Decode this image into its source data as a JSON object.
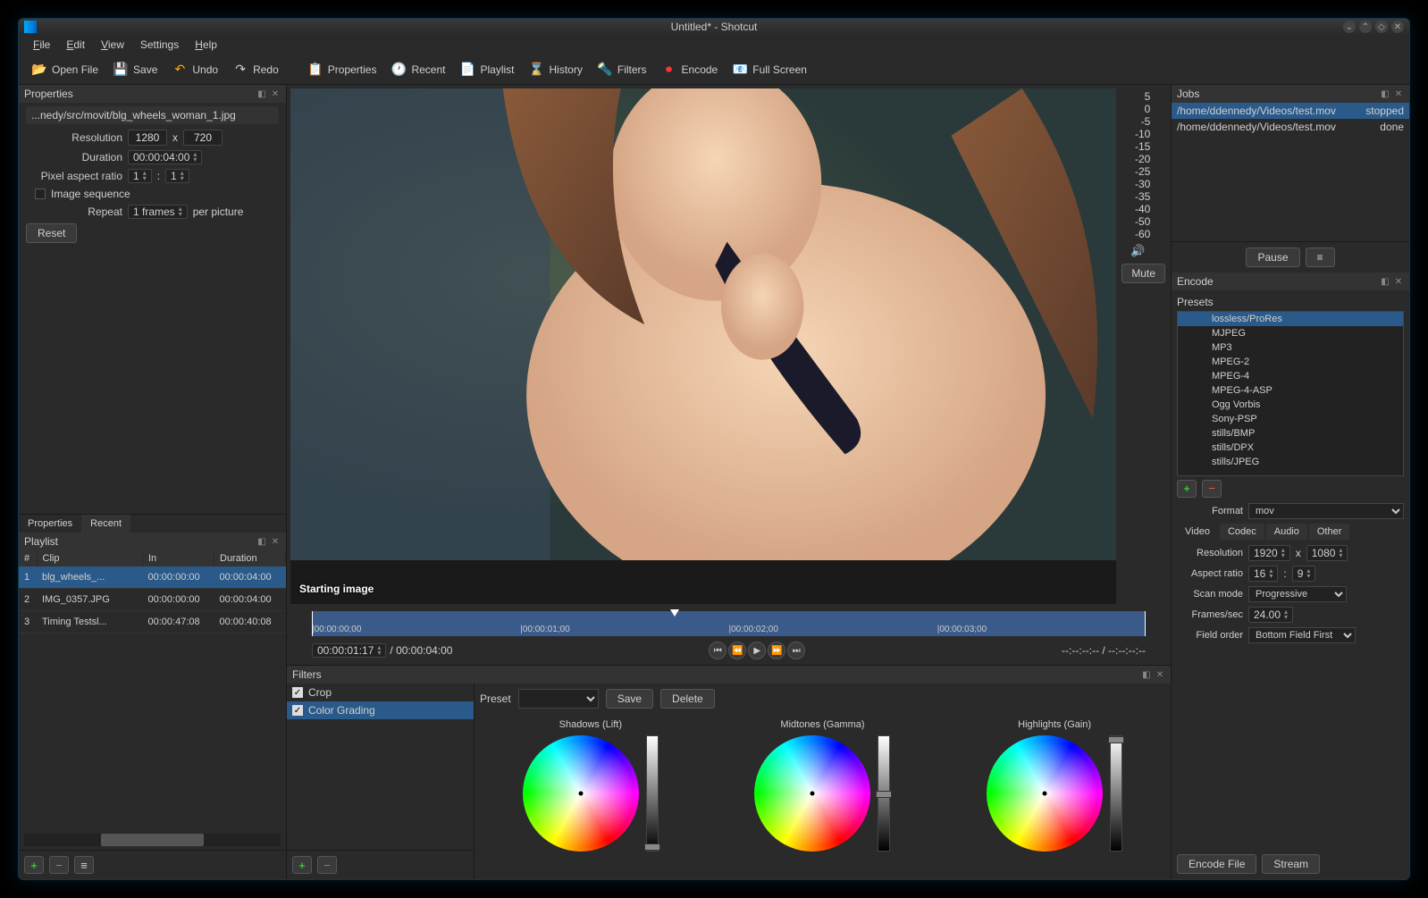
{
  "window": {
    "title": "Untitled* - Shotcut"
  },
  "menu": {
    "file": "File",
    "edit": "Edit",
    "view": "View",
    "settings": "Settings",
    "help": "Help"
  },
  "toolbar": {
    "open": "Open File",
    "save": "Save",
    "undo": "Undo",
    "redo": "Redo",
    "properties": "Properties",
    "recent": "Recent",
    "playlist": "Playlist",
    "history": "History",
    "filters": "Filters",
    "encode": "Encode",
    "fullscreen": "Full Screen"
  },
  "properties": {
    "title": "Properties",
    "filename": "...nedy/src/movit/blg_wheels_woman_1.jpg",
    "resolution_label": "Resolution",
    "res_w": "1280",
    "res_x": "x",
    "res_h": "720",
    "duration_label": "Duration",
    "duration": "00:00:04:00",
    "par_label": "Pixel aspect ratio",
    "par_a": "1",
    "par_sep": ":",
    "par_b": "1",
    "imgseq_label": "Image sequence",
    "repeat_label": "Repeat",
    "repeat_val": "1 frames",
    "repeat_unit": "per picture",
    "reset": "Reset"
  },
  "tabs": {
    "properties": "Properties",
    "recent": "Recent"
  },
  "playlist": {
    "title": "Playlist",
    "cols": {
      "num": "#",
      "clip": "Clip",
      "in": "In",
      "dur": "Duration"
    },
    "rows": [
      {
        "n": "1",
        "clip": "blg_wheels_...",
        "in": "00:00:00:00",
        "dur": "00:00:04:00",
        "sel": true
      },
      {
        "n": "2",
        "clip": "IMG_0357.JPG",
        "in": "00:00:00:00",
        "dur": "00:00:04:00"
      },
      {
        "n": "3",
        "clip": "Timing Testsl...",
        "in": "00:00:47:08",
        "dur": "00:00:40:08"
      }
    ]
  },
  "preview": {
    "label": "Starting image",
    "mute": "Mute",
    "scale": [
      "5",
      "0",
      "-5",
      "-10",
      "-15",
      "-20",
      "-25",
      "-30",
      "-35",
      "-40",
      "-50",
      "-60"
    ],
    "ticks": [
      "00:00:00;00",
      "00:00:01;00",
      "00:00:02;00",
      "00:00:03;00"
    ],
    "tc_cur": "00:00:01:17",
    "tc_total": "/ 00:00:04:00",
    "inout": "--:--:--:-- / --:--:--:--"
  },
  "filters": {
    "title": "Filters",
    "items": [
      {
        "name": "Crop",
        "sel": false
      },
      {
        "name": "Color Grading",
        "sel": true
      }
    ],
    "preset_label": "Preset",
    "save": "Save",
    "delete": "Delete",
    "wheels": {
      "shadows": "Shadows (Lift)",
      "midtones": "Midtones (Gamma)",
      "highlights": "Highlights (Gain)"
    }
  },
  "jobs": {
    "title": "Jobs",
    "rows": [
      {
        "path": "/home/ddennedy/Videos/test.mov",
        "status": "stopped",
        "sel": true
      },
      {
        "path": "/home/ddennedy/Videos/test.mov",
        "status": "done"
      }
    ],
    "pause": "Pause",
    "menu": "≡"
  },
  "encode": {
    "title": "Encode",
    "presets_label": "Presets",
    "presets": [
      "lossless/ProRes",
      "MJPEG",
      "MP3",
      "MPEG-2",
      "MPEG-4",
      "MPEG-4-ASP",
      "Ogg Vorbis",
      "Sony-PSP",
      "stills/BMP",
      "stills/DPX",
      "stills/JPEG"
    ],
    "preset_sel": 0,
    "format_label": "Format",
    "format": "mov",
    "tabs": [
      "Video",
      "Codec",
      "Audio",
      "Other"
    ],
    "tab_active": 0,
    "v_res_label": "Resolution",
    "v_res_w": "1920",
    "v_res_h": "1080",
    "v_ar_label": "Aspect ratio",
    "v_ar_a": "16",
    "v_ar_b": "9",
    "v_scan_label": "Scan mode",
    "v_scan": "Progressive",
    "v_fps_label": "Frames/sec",
    "v_fps": "24.00",
    "v_fo_label": "Field order",
    "v_fo": "Bottom Field First",
    "encode_file": "Encode File",
    "stream": "Stream"
  }
}
